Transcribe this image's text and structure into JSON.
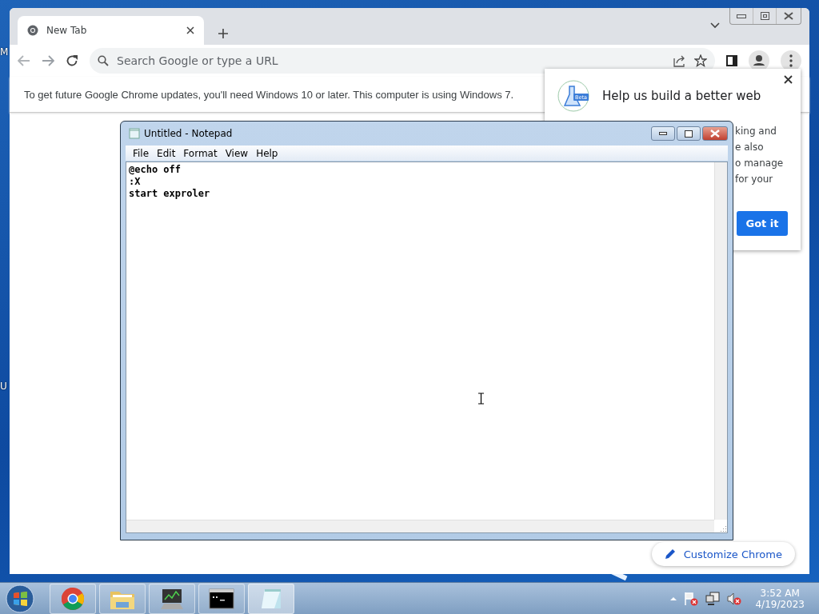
{
  "desktop": {
    "edge_labels": [
      "M",
      "U"
    ]
  },
  "browser": {
    "tabs": [
      {
        "title": "New Tab",
        "selected": true
      }
    ],
    "omnibox": {
      "placeholder": "Search Google or type a URL"
    },
    "infobar": "To get future Google Chrome updates, you'll need Windows 10 or later. This computer is using Windows 7.",
    "customize_button": "Customize Chrome"
  },
  "popup": {
    "badge": "Beta",
    "title": "Help us build a better web",
    "body_lines": [
      "king and",
      "e also",
      "o manage",
      "for your"
    ],
    "button": "Got it"
  },
  "notepad": {
    "title": "Untitled - Notepad",
    "menu": [
      "File",
      "Edit",
      "Format",
      "View",
      "Help"
    ],
    "text_lines": [
      "@echo off",
      ":X",
      "start exproler"
    ]
  },
  "taskbar": {
    "apps": [
      {
        "kind": "chrome",
        "selected": false
      },
      {
        "kind": "folder",
        "selected": false
      },
      {
        "kind": "monitor",
        "selected": false
      },
      {
        "kind": "console",
        "selected": false
      },
      {
        "kind": "notepad",
        "selected": true
      }
    ],
    "time": "3:52 AM",
    "date": "4/19/2023"
  }
}
